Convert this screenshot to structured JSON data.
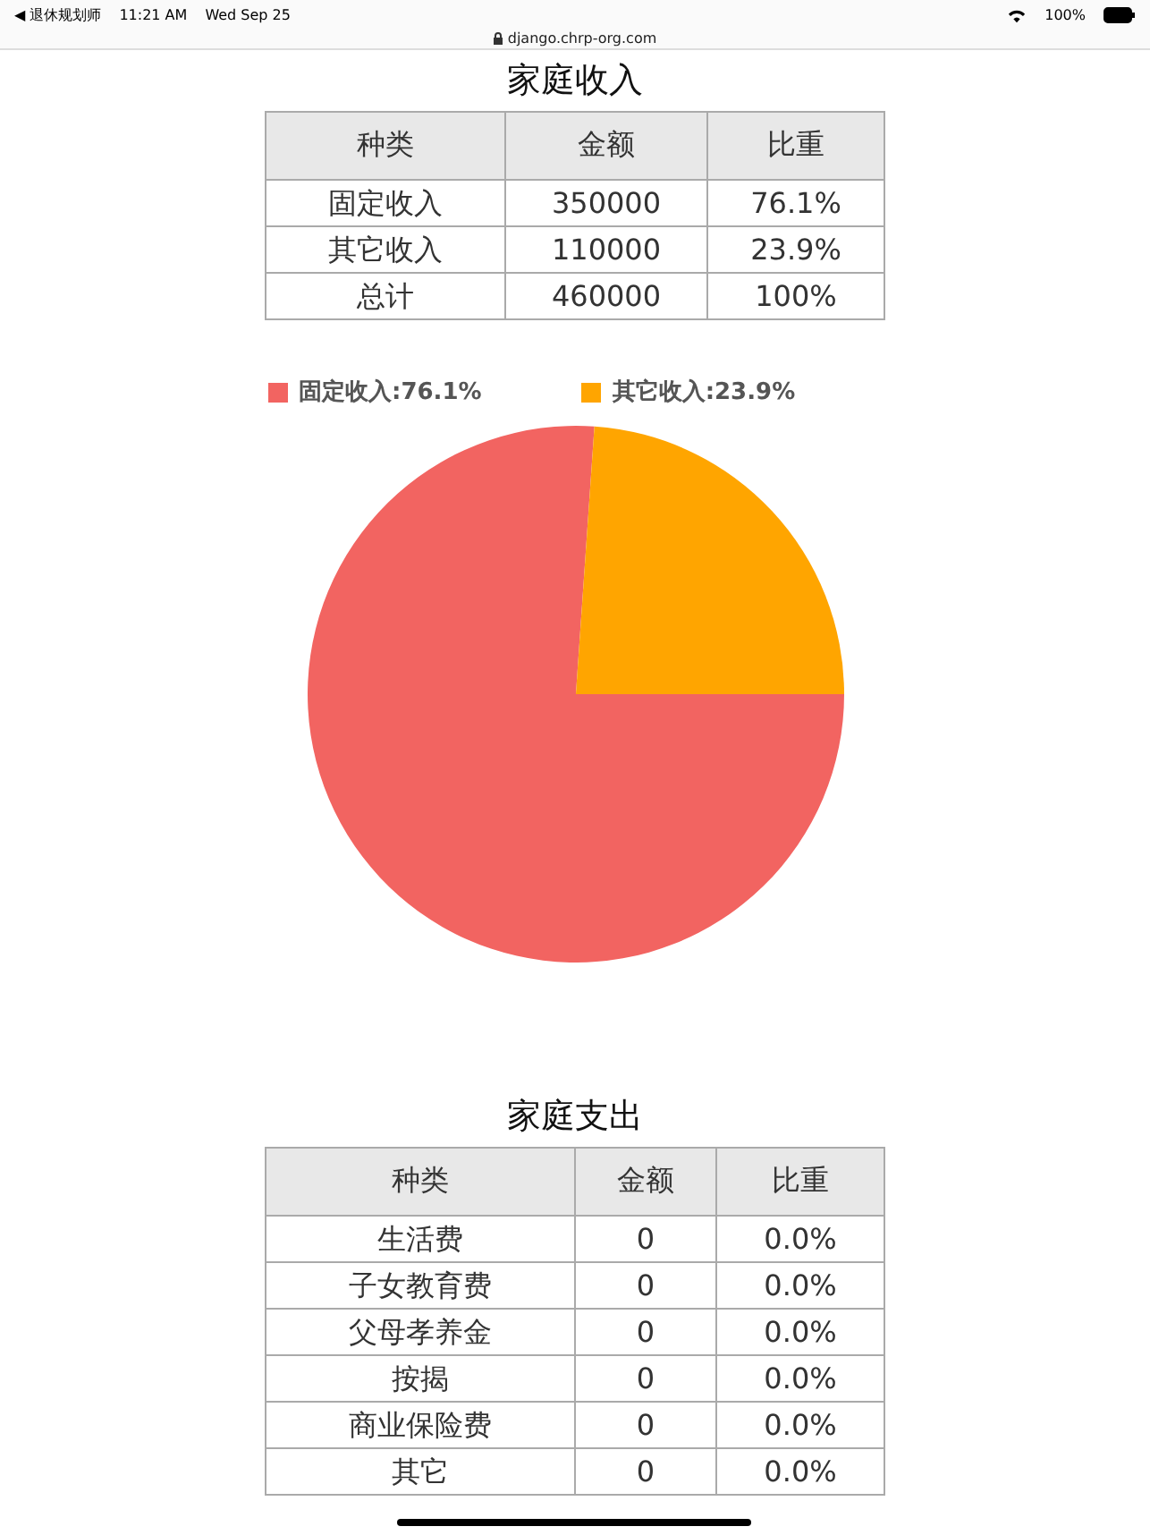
{
  "status_bar": {
    "back_app": "◀ 退休规划师",
    "time": "11:21 AM",
    "date": "Wed Sep 25",
    "url": "django.chrp-org.com",
    "battery": "100%"
  },
  "income": {
    "title": "家庭收入",
    "columns": [
      "种类",
      "金额",
      "比重"
    ],
    "rows": [
      [
        "固定收入",
        "350000",
        "76.1%"
      ],
      [
        "其它收入",
        "110000",
        "23.9%"
      ],
      [
        "总计",
        "460000",
        "100%"
      ]
    ],
    "legend": [
      {
        "label": "固定收入:76.1%",
        "color": "#f26461"
      },
      {
        "label": "其它收入:23.9%",
        "color": "#ffa500"
      }
    ],
    "chart_data": {
      "type": "pie",
      "values": [
        76.1,
        23.9
      ]
    }
  },
  "expense": {
    "title": "家庭支出",
    "columns": [
      "种类",
      "金额",
      "比重"
    ],
    "rows": [
      [
        "生活费",
        "0",
        "0.0%"
      ],
      [
        "子女教育费",
        "0",
        "0.0%"
      ],
      [
        "父母孝养金",
        "0",
        "0.0%"
      ],
      [
        "按揭",
        "0",
        "0.0%"
      ],
      [
        "商业保险费",
        "0",
        "0.0%"
      ],
      [
        "其它",
        "0",
        "0.0%"
      ]
    ]
  }
}
